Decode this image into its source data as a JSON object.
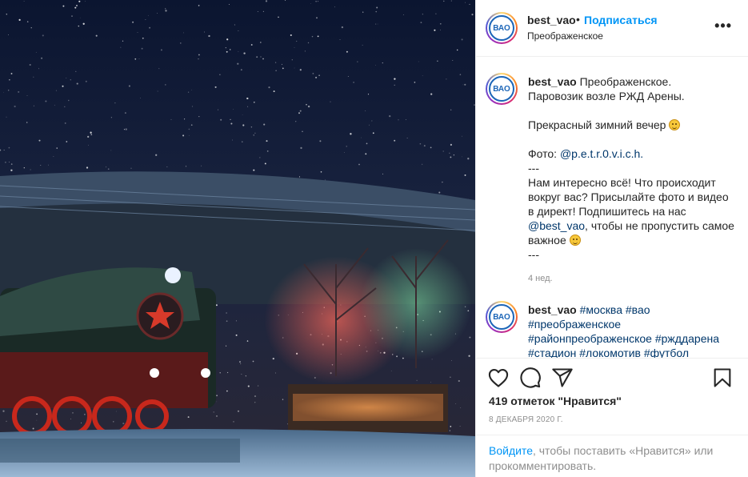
{
  "post": {
    "username": "best_vao",
    "separator": "•",
    "follow_label": "Подписаться",
    "location": "Преображенское",
    "more_label": "•••",
    "avatar_text": "ВАО"
  },
  "caption": {
    "username": "best_vao",
    "line1": "Преображенское.",
    "line2": "Паровозик возле РЖД Арены.",
    "line3": "Прекрасный зимний вечер",
    "photo_prefix": "Фото: ",
    "photo_handle": "@p.e.t.r.0.v.i.c.h.",
    "dashes1": "---",
    "body1": "Нам интересно всё! Что происходит вокруг вас? Присылайте фото и видео в директ! Подпишитесь на нас ",
    "mention": "@best_vao",
    "body2": ", чтобы не пропустить самое важное",
    "dashes2": "---",
    "time": "4 нед."
  },
  "comment2": {
    "username": "best_vao",
    "tags_line1": "#москва #вао",
    "tags_line2": "#преображенское",
    "tags_line3": "#районпреображенское #ржддарена",
    "tags_line4": "#стадион #локомотив #футбол"
  },
  "actions": {
    "likes": "419 отметок \"Нравится\"",
    "date": "8 ДЕКАБРЯ 2020 Г."
  },
  "login": {
    "link": "Войдите",
    "rest": ", чтобы поставить «Нравится» или прокомментировать."
  },
  "colors": {
    "accent": "#0095f6",
    "link": "#00376b",
    "muted": "#8e8e8e"
  },
  "icons": [
    "heart-icon",
    "comment-icon",
    "share-icon",
    "bookmark-icon"
  ]
}
